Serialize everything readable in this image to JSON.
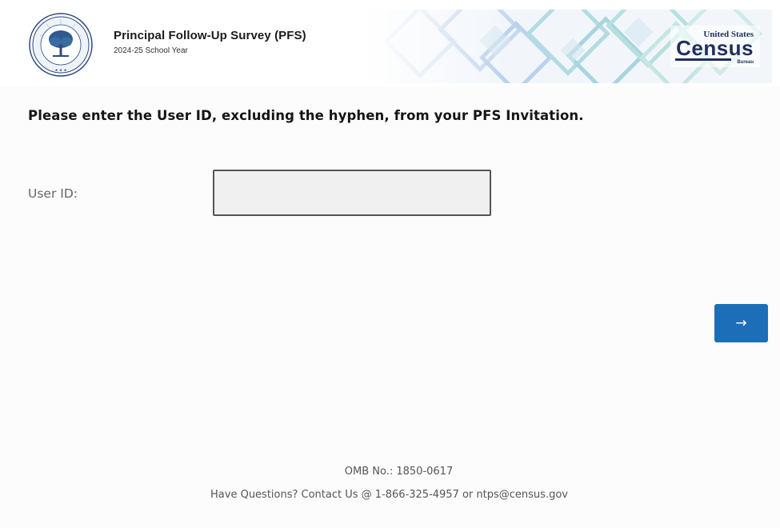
{
  "header": {
    "seal_icon": "department-of-education-seal",
    "title": "Principal Follow-Up Survey (PFS)",
    "subtitle": "2024-25 School Year",
    "logo": {
      "icon": "census-bureau-logo",
      "line1": "United States",
      "line2": "Census",
      "line3": "Bureau",
      "color": "#1f2f5c"
    }
  },
  "instruction": "Please enter the User ID, excluding the hyphen, from your PFS Invitation.",
  "form": {
    "user_id_label": "User ID:",
    "user_id_value": "",
    "user_id_placeholder": ""
  },
  "next_button": {
    "icon": "arrow-right-icon",
    "glyph": "→",
    "color": "#1d6eb8"
  },
  "footer": {
    "omb": "OMB No.: 1850-0617",
    "contact": "Have Questions? Contact Us @ 1-866-325-4957 or ntps@census.gov"
  }
}
